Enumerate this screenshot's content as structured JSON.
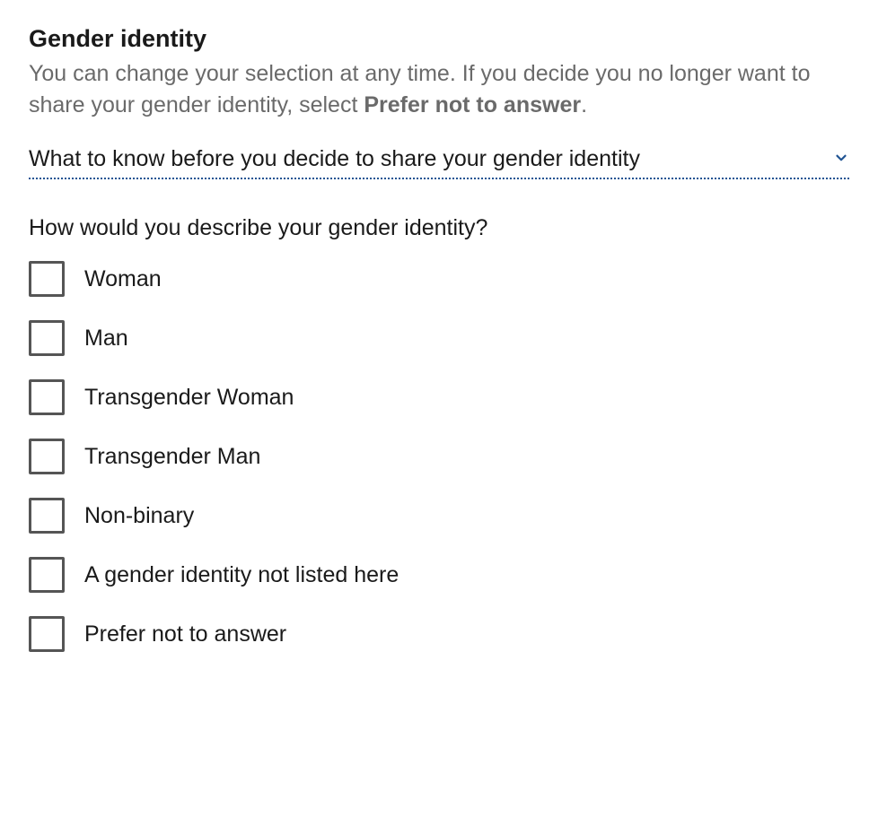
{
  "section": {
    "title": "Gender identity",
    "description_pre": "You can change your selection at any time. If you decide you no longer want to share your gender identity, select ",
    "description_bold": "Prefer not to answer",
    "description_post": "."
  },
  "disclosure": {
    "label": "What to know before you decide to share your gender identity"
  },
  "question": {
    "label": "How would you describe your gender identity?",
    "options": [
      {
        "label": "Woman"
      },
      {
        "label": "Man"
      },
      {
        "label": "Transgender Woman"
      },
      {
        "label": "Transgender Man"
      },
      {
        "label": "Non-binary"
      },
      {
        "label": "A gender identity not listed here"
      },
      {
        "label": "Prefer not to answer"
      }
    ]
  }
}
